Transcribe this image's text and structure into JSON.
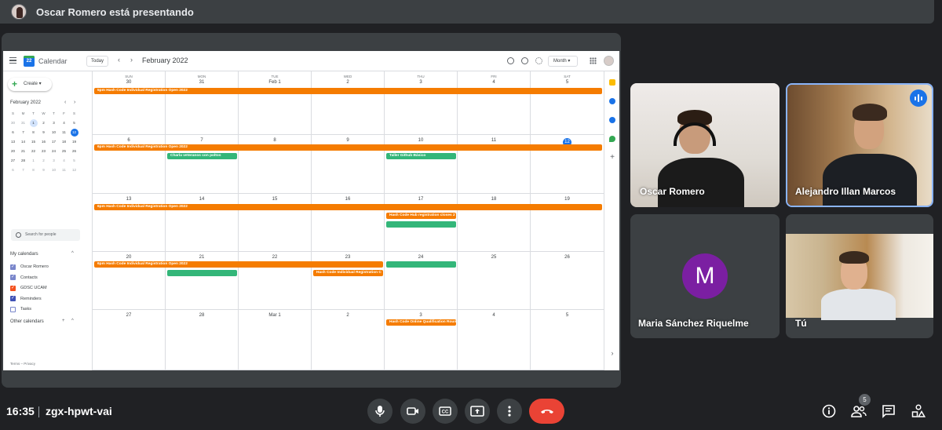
{
  "presenting_bar": {
    "text": "Oscar Romero está presentando"
  },
  "calendar": {
    "app_name": "Calendar",
    "logo_day": "22",
    "today_button": "Today",
    "month_title": "February 2022",
    "view_select": "Month",
    "create_label": "Create",
    "mini_month": {
      "title": "February 2022",
      "headers": [
        "S",
        "M",
        "T",
        "W",
        "T",
        "F",
        "S"
      ],
      "rows": [
        [
          "30",
          "31",
          "1",
          "2",
          "3",
          "4",
          "5"
        ],
        [
          "6",
          "7",
          "8",
          "9",
          "10",
          "11",
          "12"
        ],
        [
          "13",
          "14",
          "15",
          "16",
          "17",
          "18",
          "19"
        ],
        [
          "20",
          "21",
          "22",
          "23",
          "24",
          "25",
          "26"
        ],
        [
          "27",
          "28",
          "1",
          "2",
          "3",
          "4",
          "5"
        ],
        [
          "6",
          "7",
          "8",
          "9",
          "10",
          "11",
          "12"
        ]
      ]
    },
    "search_people_placeholder": "Search for people",
    "my_calendars_title": "My calendars",
    "my_calendars": [
      {
        "label": "Oscar Romero",
        "color": "#7986cb"
      },
      {
        "label": "Contacts",
        "color": "#7986cb"
      },
      {
        "label": "GDSC UCAM",
        "color": "#f4511e"
      },
      {
        "label": "Reminders",
        "color": "#3f51b5"
      },
      {
        "label": "Tasks",
        "color": "#ffffff"
      }
    ],
    "other_calendars_title": "Other calendars",
    "terms": "Terms – Privacy",
    "weekday_headers": [
      "SUN",
      "MON",
      "TUE",
      "WED",
      "THU",
      "FRI",
      "SAT"
    ],
    "weeks": [
      [
        "30",
        "31",
        "Feb 1",
        "2",
        "3",
        "4",
        "5"
      ],
      [
        "6",
        "7",
        "8",
        "9",
        "10",
        "11",
        "12"
      ],
      [
        "13",
        "14",
        "15",
        "16",
        "17",
        "18",
        "19"
      ],
      [
        "20",
        "21",
        "22",
        "23",
        "24",
        "25",
        "26"
      ],
      [
        "27",
        "28",
        "Mar 1",
        "2",
        "3",
        "4",
        "5"
      ]
    ],
    "events": {
      "w1_hashcode": "5pm Hash Code Individual Registration Open 2022",
      "w2_hashcode": "6pm Hash Code Individual Registration Open 2022",
      "w2_charla": "Charla veteranos con poltos",
      "w2_taller": "Taller Github Básico",
      "w3_hashcode": "6pm Hash Code Individual Registration Open 2022",
      "w3_hub": "Hash Code Hub registration closes 2",
      "w4_hashcode": "6pm Hash Code Individual Registration Open 2022",
      "w4_hashcode2": "Hash Code Individual Registration C",
      "w5_qualif": "Hash Code Online Qualification Roun"
    },
    "colors": {
      "orange": "#f57c00",
      "green": "#33b679",
      "blue": "#1a73e8"
    }
  },
  "participants": [
    {
      "name": "Oscar Romero"
    },
    {
      "name": "Alejandro Illan Marcos"
    },
    {
      "name": "Maria Sánchez Riquelme",
      "initial": "M"
    },
    {
      "name": "Tú"
    }
  ],
  "bottom_bar": {
    "time": "16:35",
    "meeting_code": "zgx-hpwt-vai",
    "people_count": "5"
  }
}
